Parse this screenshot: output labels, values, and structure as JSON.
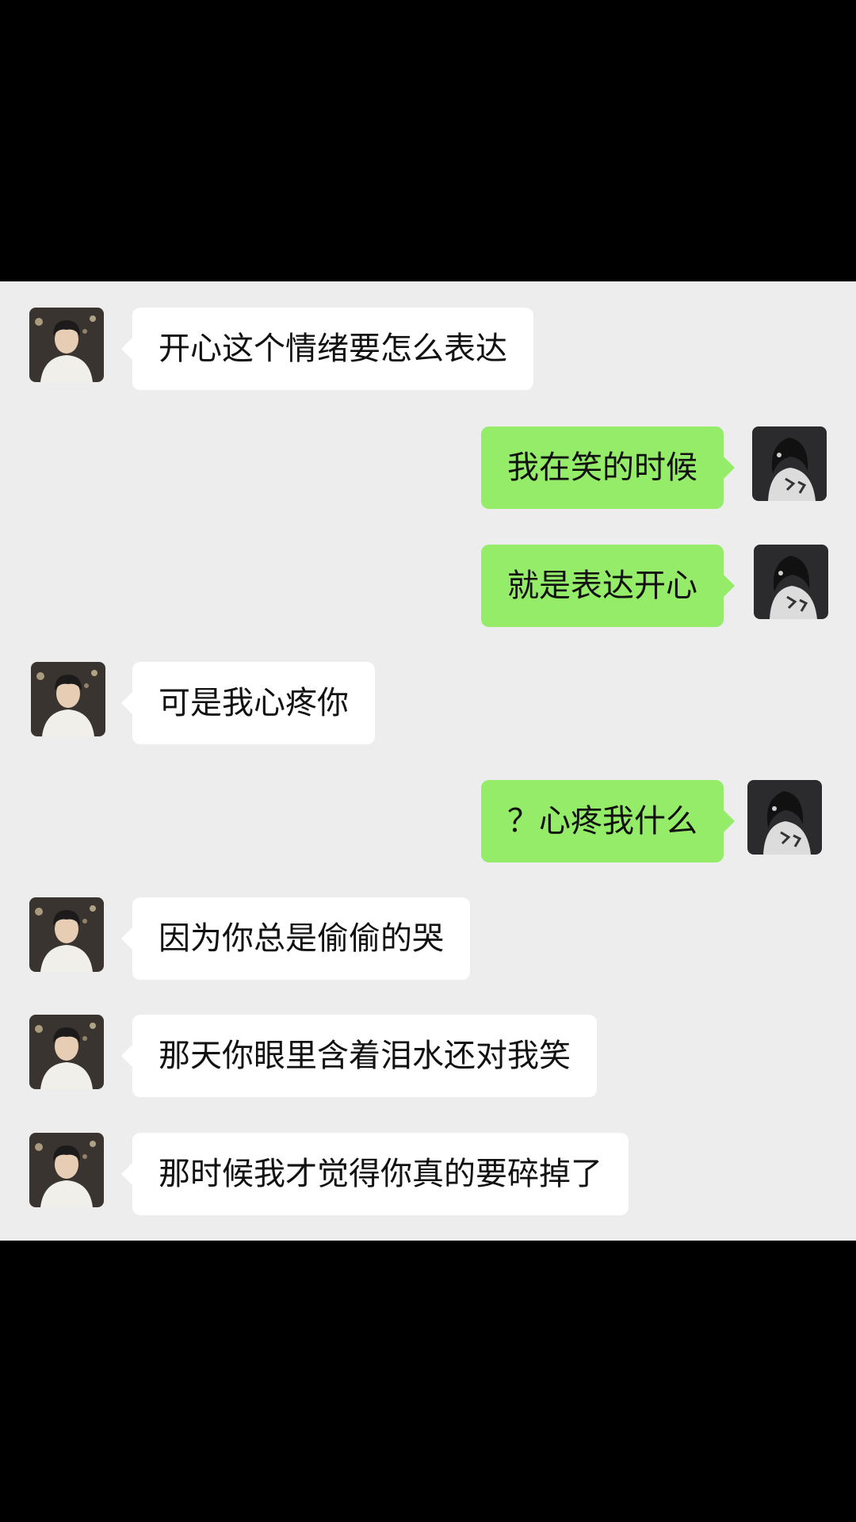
{
  "conversation": {
    "messages": [
      {
        "side": "left",
        "text": "开心这个情绪要怎么表达",
        "avatar": "contact-avatar-boy"
      },
      {
        "side": "right",
        "text": "我在笑的时候",
        "avatar": "my-avatar-girl"
      },
      {
        "side": "right",
        "text": "就是表达开心",
        "avatar": "my-avatar-girl"
      },
      {
        "side": "left",
        "text": "可是我心疼你",
        "avatar": "contact-avatar-boy"
      },
      {
        "side": "right",
        "text": "？心疼我什么",
        "avatar": "my-avatar-girl"
      },
      {
        "side": "left",
        "text": "因为你总是偷偷的哭",
        "avatar": "contact-avatar-boy"
      },
      {
        "side": "left",
        "text": "那天你眼里含着泪水还对我笑",
        "avatar": "contact-avatar-boy"
      },
      {
        "side": "left",
        "text": "那时候我才觉得你真的要碎掉了",
        "avatar": "contact-avatar-boy"
      }
    ]
  },
  "colors": {
    "background": "#000000",
    "chat_background": "#ededed",
    "incoming_bubble": "#ffffff",
    "outgoing_bubble": "#95ec69",
    "text": "#111111"
  }
}
